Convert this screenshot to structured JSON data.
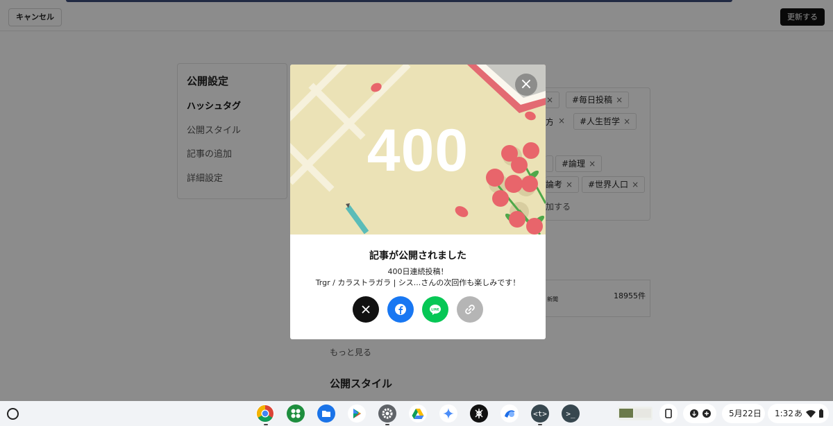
{
  "topbar": {
    "cancel_label": "キャンセル",
    "update_label": "更新する"
  },
  "sidebar": {
    "title": "公開設定",
    "items": [
      {
        "label": "ハッシュタグ"
      },
      {
        "label": "公開スタイル"
      },
      {
        "label": "記事の追加"
      },
      {
        "label": "詳細設定"
      }
    ]
  },
  "hashtags": {
    "tags": [
      "#毎日投稿",
      "#人生哲学",
      "#論理",
      "#世界人口"
    ],
    "fragments": [
      "方",
      "論考",
      "加する"
    ]
  },
  "list": {
    "count": "18955件",
    "fragment": "新聞"
  },
  "main": {
    "more_label": "もっと見る",
    "section_title": "公開スタイル"
  },
  "modal": {
    "number": "400",
    "title": "記事が公開されました",
    "line1": "400日連続投稿！",
    "line2": "Trgr / カラストラガラ | シス...さんの次回作も楽しみです！",
    "share": [
      {
        "icon": "x-logo-icon",
        "color": "#111111"
      },
      {
        "icon": "facebook-icon",
        "color": "#1877f2"
      },
      {
        "icon": "line-icon",
        "color": "#06c755"
      },
      {
        "icon": "link-icon",
        "color": "#b5b5b5"
      }
    ]
  },
  "taskbar": {
    "date": "5月22日",
    "time": "1:32",
    "ime": "あ",
    "apps": [
      "chrome-icon",
      "google-apps-icon",
      "files-icon",
      "play-store-icon",
      "settings-icon",
      "drive-icon",
      "gemini-icon",
      "app-icon",
      "duolingo-icon",
      "text-editor-icon",
      "terminal-icon"
    ]
  },
  "colors": {
    "accent": "#111111",
    "illustration_bg": "#ebe2b6",
    "flower": "#e8656b"
  }
}
